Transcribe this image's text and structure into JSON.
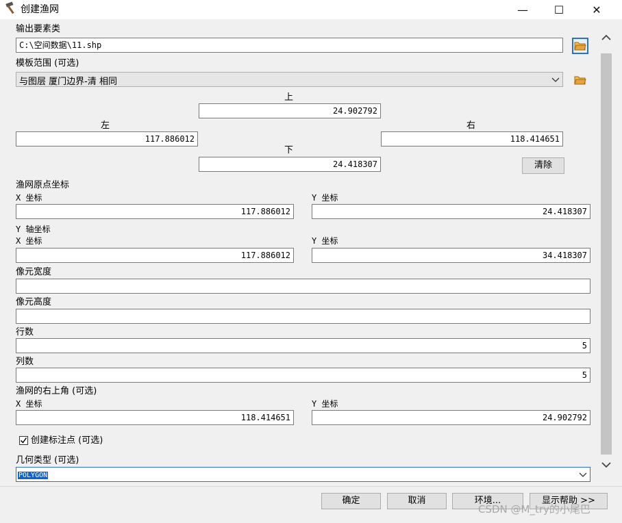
{
  "window": {
    "title": "创建渔网",
    "minimize_glyph": "—",
    "maximize_glyph": "☐",
    "close_glyph": "✕"
  },
  "output": {
    "label": "输出要素类",
    "value": "C:\\空间数据\\11.shp"
  },
  "template": {
    "label": "模板范围 (可选)",
    "value": "与图层 厦门边界-清 相同",
    "top_label": "上",
    "top_value": "24.902792",
    "left_label": "左",
    "left_value": "117.886012",
    "right_label": "右",
    "right_value": "118.414651",
    "bottom_label": "下",
    "bottom_value": "24.418307",
    "clear_button": "清除"
  },
  "origin": {
    "label": "渔网原点坐标",
    "x_label": "X 坐标",
    "x_value": "117.886012",
    "y_label": "Y 坐标",
    "y_value": "24.418307"
  },
  "yaxis": {
    "label": "Y 轴坐标",
    "x_label": "X 坐标",
    "x_value": "117.886012",
    "y_label": "Y 坐标",
    "y_value": "34.418307"
  },
  "cell_width": {
    "label": "像元宽度",
    "value": ""
  },
  "cell_height": {
    "label": "像元高度",
    "value": ""
  },
  "rows": {
    "label": "行数",
    "value": "5"
  },
  "cols": {
    "label": "列数",
    "value": "5"
  },
  "corner": {
    "label": "渔网的右上角 (可选)",
    "x_label": "X 坐标",
    "x_value": "118.414651",
    "y_label": "Y 坐标",
    "y_value": "24.902792"
  },
  "labels_checkbox": {
    "label": "创建标注点 (可选)",
    "checked": true
  },
  "geometry": {
    "label": "几何类型 (可选)",
    "value": "POLYGON"
  },
  "buttons": {
    "ok": "确定",
    "cancel": "取消",
    "env": "环境...",
    "help": "显示帮助 >>"
  },
  "watermark": "CSDN @M_try的小尾巴",
  "colors": {
    "accent": "#2a6fd1",
    "selection": "#0a64d2",
    "folder": "#e8a33c"
  }
}
